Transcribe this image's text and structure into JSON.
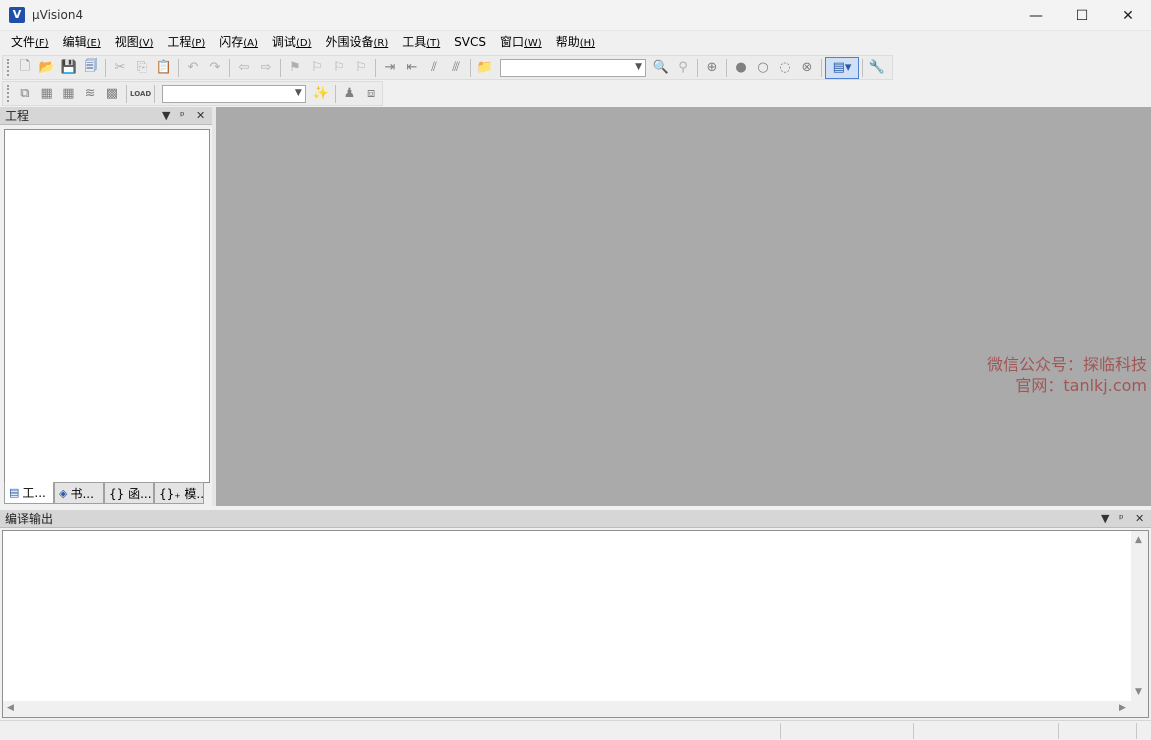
{
  "window": {
    "title": "µVision4",
    "app_icon_glyph": "V",
    "minimize_glyph": "—",
    "maximize_glyph": "☐",
    "close_glyph": "✕"
  },
  "menu": [
    {
      "label": "文件",
      "key": "(F)"
    },
    {
      "label": "编辑",
      "key": "(E)"
    },
    {
      "label": "视图",
      "key": "(V)"
    },
    {
      "label": "工程",
      "key": "(P)"
    },
    {
      "label": "闪存",
      "key": "(A)"
    },
    {
      "label": "调试",
      "key": "(D)"
    },
    {
      "label": "外围设备",
      "key": "(R)"
    },
    {
      "label": "工具",
      "key": "(T)"
    },
    {
      "label": "SVCS",
      "key": ""
    },
    {
      "label": "窗口",
      "key": "(W)"
    },
    {
      "label": "帮助",
      "key": "(H)"
    }
  ],
  "toolbar1": {
    "combo_value": "",
    "load_label": "LOAD"
  },
  "toolbar2": {
    "combo_value": ""
  },
  "project_pane": {
    "title": "工程",
    "dropdown_glyph": "▼",
    "pin_glyph": "ᵖ",
    "close_glyph": "✕",
    "tabs": [
      {
        "label": "工...",
        "icon": "project-icon"
      },
      {
        "label": "书...",
        "icon": "books-icon"
      },
      {
        "label": "{} 函...",
        "icon": "functions-icon"
      },
      {
        "label": "{}₊ 模...",
        "icon": "templates-icon"
      }
    ]
  },
  "watermark": {
    "line1": "微信公众号：探临科技",
    "line2": "官网：tanlkj.com"
  },
  "output_pane": {
    "title": "编译输出",
    "dropdown_glyph": "▼",
    "pin_glyph": "ᵖ",
    "close_glyph": "✕"
  },
  "colors": {
    "workspace": "#aaaaaa",
    "watermark": "#a04848",
    "accent": "#2a5aa8"
  }
}
